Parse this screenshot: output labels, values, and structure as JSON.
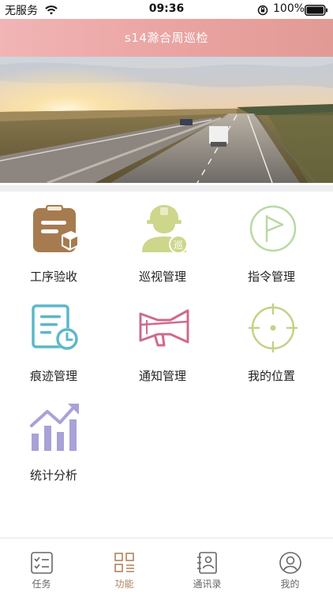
{
  "status_bar": {
    "carrier": "无服务",
    "time": "09:36",
    "battery": "100%"
  },
  "header": {
    "title": "s14滁合周巡检"
  },
  "banner": {
    "slide_count": 4,
    "active_slide": 1
  },
  "grid": [
    {
      "label": "工序验收",
      "icon": "clipboard-icon",
      "color": "#a77b50"
    },
    {
      "label": "巡视管理",
      "icon": "inspector-icon",
      "color": "#cdd68b"
    },
    {
      "label": "指令管理",
      "icon": "flag-icon",
      "color": "#b9d9a2"
    },
    {
      "label": "痕迹管理",
      "icon": "document-clock-icon",
      "color": "#5cb8c8"
    },
    {
      "label": "通知管理",
      "icon": "megaphone-icon",
      "color": "#cf6b8a"
    },
    {
      "label": "我的位置",
      "icon": "crosshair-icon",
      "color": "#c8cf85"
    },
    {
      "label": "统计分析",
      "icon": "bar-chart-icon",
      "color": "#a8a2d8"
    }
  ],
  "tabs": [
    {
      "label": "任务",
      "icon": "task-icon"
    },
    {
      "label": "功能",
      "icon": "grid-icon",
      "active": true
    },
    {
      "label": "通讯录",
      "icon": "contacts-icon"
    },
    {
      "label": "我的",
      "icon": "user-icon"
    }
  ],
  "colors": {
    "header_start": "#f1b5b5",
    "header_end": "#e29a95",
    "tab_active": "#b1825c",
    "dot_active": "#e0231c"
  }
}
